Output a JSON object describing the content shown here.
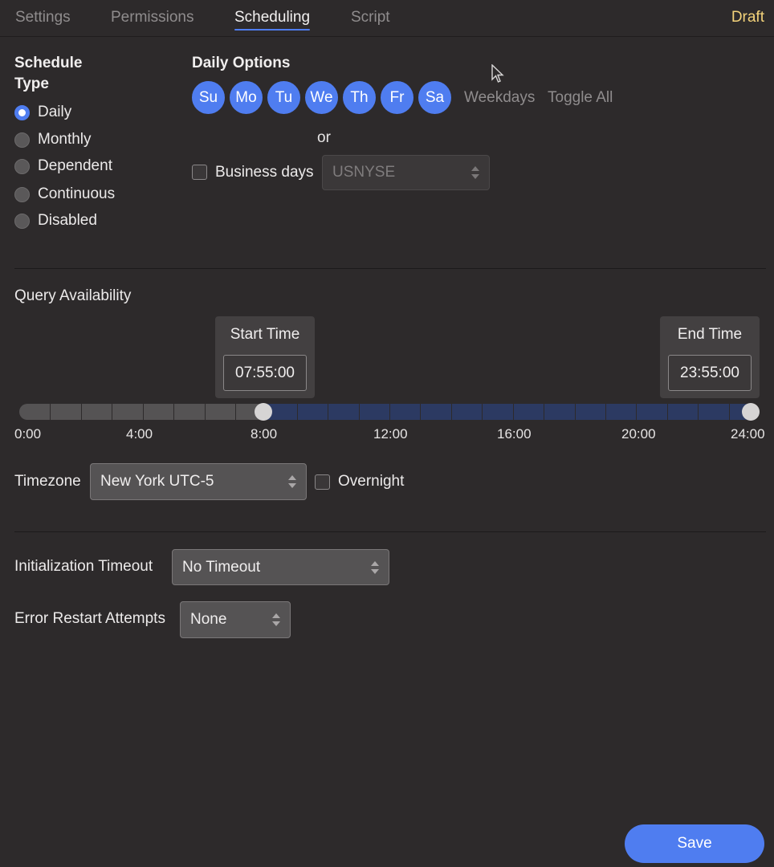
{
  "tabs": [
    {
      "label": "Settings",
      "active": false
    },
    {
      "label": "Permissions",
      "active": false
    },
    {
      "label": "Scheduling",
      "active": true
    },
    {
      "label": "Script",
      "active": false
    }
  ],
  "status_badge": "Draft",
  "schedule_type": {
    "title": "Schedule Type",
    "options": [
      {
        "label": "Daily",
        "checked": true
      },
      {
        "label": "Monthly",
        "checked": false
      },
      {
        "label": "Dependent",
        "checked": false
      },
      {
        "label": "Continuous",
        "checked": false
      },
      {
        "label": "Disabled",
        "checked": false
      }
    ]
  },
  "daily_options": {
    "title": "Daily Options",
    "days": [
      "Su",
      "Mo",
      "Tu",
      "We",
      "Th",
      "Fr",
      "Sa"
    ],
    "weekdays_label": "Weekdays",
    "toggle_all_label": "Toggle All",
    "or_label": "or",
    "business_days_label": "Business days",
    "business_days_checked": false,
    "calendar_value": "USNYSE"
  },
  "query_availability": {
    "title": "Query Availability",
    "start_time_label": "Start Time",
    "start_time": "07:55:00",
    "end_time_label": "End Time",
    "end_time": "23:55:00",
    "axis_labels": [
      "0:00",
      "4:00",
      "8:00",
      "12:00",
      "16:00",
      "20:00",
      "24:00"
    ],
    "range_start_hours": 7.9167,
    "range_end_hours": 23.9167,
    "timezone_label": "Timezone",
    "timezone_value": "New York UTC-5",
    "overnight_label": "Overnight",
    "overnight_checked": false
  },
  "initialization_timeout": {
    "label": "Initialization Timeout",
    "value": "No Timeout"
  },
  "error_restart_attempts": {
    "label": "Error Restart Attempts",
    "value": "None"
  },
  "save_label": "Save",
  "colors": {
    "accent": "#4f7df0",
    "draft": "#f3d27a",
    "background": "#2d2a2b",
    "range_fill": "#2c3a62"
  }
}
